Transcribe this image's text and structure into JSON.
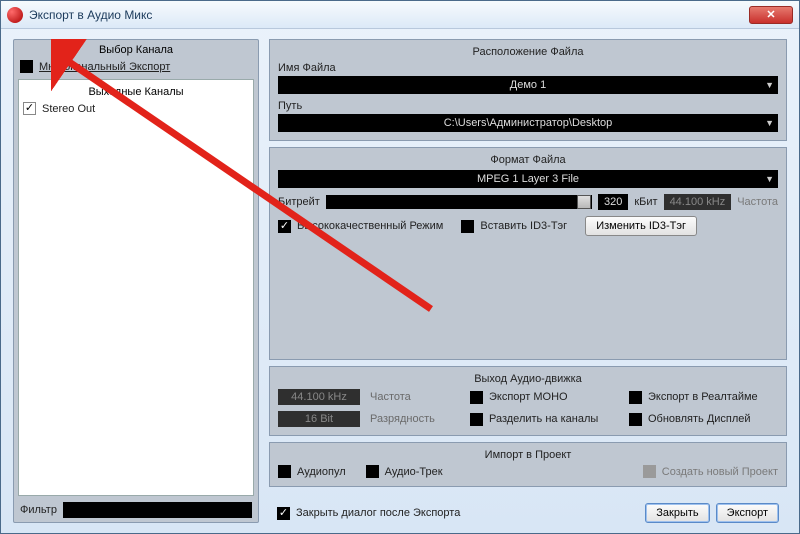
{
  "window": {
    "title": "Экспорт в Аудио Микс",
    "close_glyph": "✕"
  },
  "left_panel": {
    "title": "Выбор Канала",
    "multichannel_label": "Многоканальный Экспорт",
    "output_channels_header": "Выходные Каналы",
    "stereo_out_label": "Stereo Out",
    "filter_label": "Фильтр",
    "filter_value": ""
  },
  "file_location": {
    "title": "Расположение Файла",
    "name_label": "Имя Файла",
    "name_value": "Демо 1",
    "path_label": "Путь",
    "path_value": "C:\\Users\\Администратор\\Desktop"
  },
  "file_format": {
    "title": "Формат Файла",
    "format_value": "MPEG 1 Layer 3 File",
    "bitrate_label": "Битрейт",
    "bitrate_value": "320",
    "bitrate_unit": "кБит",
    "samplerate_value": "44.100 kHz",
    "samplerate_label": "Частота",
    "hq_label": "Высококачественный Режим",
    "insert_id3_label": "Вставить ID3-Тэг",
    "edit_id3_button": "Изменить ID3-Тэг"
  },
  "audio_engine": {
    "title": "Выход Аудио-движка",
    "samplerate_value": "44.100 kHz",
    "samplerate_label": "Частота",
    "bitdepth_value": "16 Bit",
    "bitdepth_label": "Разрядность",
    "mono_label": "Экспорт МОНО",
    "realtime_label": "Экспорт в Реалтайме",
    "split_label": "Разделить на каналы",
    "update_display_label": "Обновлять Дисплей"
  },
  "import_project": {
    "title": "Импорт в Проект",
    "audiopool_label": "Аудиопул",
    "audiotrack_label": "Аудио-Трек",
    "create_project_label": "Создать новый Проект"
  },
  "bottom": {
    "close_after_label": "Закрыть диалог после Экспорта",
    "close_button": "Закрыть",
    "export_button": "Экспорт"
  }
}
